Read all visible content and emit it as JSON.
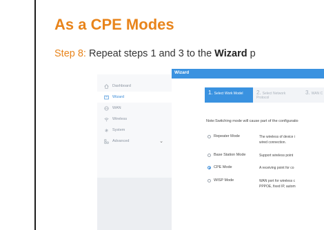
{
  "heading": "As a CPE Modes",
  "step": {
    "label": "Step 8:",
    "text_before": " Repeat steps 1 and 3 to the ",
    "bold": "Wizard",
    "text_after": " p"
  },
  "sidebar": {
    "items": [
      {
        "label": "Dashboard",
        "icon": "home-icon"
      },
      {
        "label": "Wizard",
        "icon": "wizard-icon",
        "active": true
      },
      {
        "label": "WAN",
        "icon": "globe-icon"
      },
      {
        "label": "Wireless",
        "icon": "wifi-icon"
      },
      {
        "label": "System",
        "icon": "gear-icon"
      },
      {
        "label": "Advanced",
        "icon": "advanced-icon",
        "chevron": "⌄"
      }
    ]
  },
  "topbar": {
    "title": "Wizard"
  },
  "tabs": [
    {
      "num": "1.",
      "label": "Select Work Model",
      "label2": ""
    },
    {
      "num": "2.",
      "label": "Select Network",
      "label2": "Protocol"
    },
    {
      "num": "3.",
      "label": "WAN C",
      "label2": ""
    }
  ],
  "note": "Note:Switching mode will cause part of the configuratio",
  "modes": [
    {
      "name": "Repeater Mode",
      "desc1": "The wireless of device i",
      "desc2": "wired connection.",
      "checked": false
    },
    {
      "name": "Base Station Mode",
      "desc1": "Support wireless point",
      "desc2": "",
      "checked": false
    },
    {
      "name": "CPE Mode",
      "desc1": "A receiving point for co",
      "desc2": "",
      "checked": true
    },
    {
      "name": "WISP Mode",
      "desc1": "WAN port for wireless c",
      "desc2": "PPPOE, fixed IP, autom",
      "checked": false
    }
  ],
  "colors": {
    "accent": "#e8841b",
    "ui_blue": "#3a92e0"
  }
}
